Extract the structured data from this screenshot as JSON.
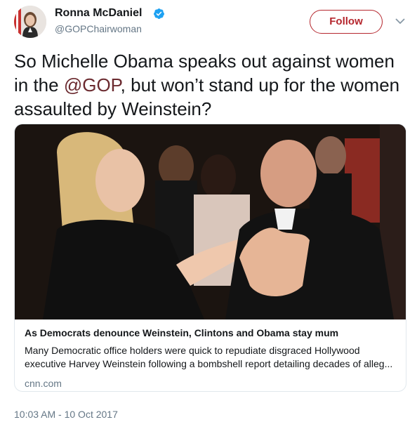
{
  "author": {
    "name": "Ronna McDaniel",
    "handle": "@GOPChairwoman",
    "verified": true,
    "avatar_icon": "profile-avatar"
  },
  "follow_label": "Follow",
  "menu_icon": "chevron-down-icon",
  "tweet": {
    "text_before": "So Michelle Obama speaks out against women in the ",
    "mention": "@GOP",
    "text_after": ", but won’t stand up for the women assaulted by Weinstein?"
  },
  "card": {
    "image_icon": "news-photo",
    "title": "As Democrats denounce Weinstein, Clintons and Obama stay mum",
    "description_line1": "Many Democratic office holders were quick to repudiate disgraced Hollywood",
    "description_line2": "executive Harvey Weinstein following a bombshell report detailing decades of alleg...",
    "domain": "cnn.com"
  },
  "timestamp": "10:03 AM - 10 Oct 2017",
  "colors": {
    "follow": "#b5272e",
    "mention": "#6b2a2f",
    "secondary_text": "#657786",
    "verified": "#1da1f2"
  }
}
